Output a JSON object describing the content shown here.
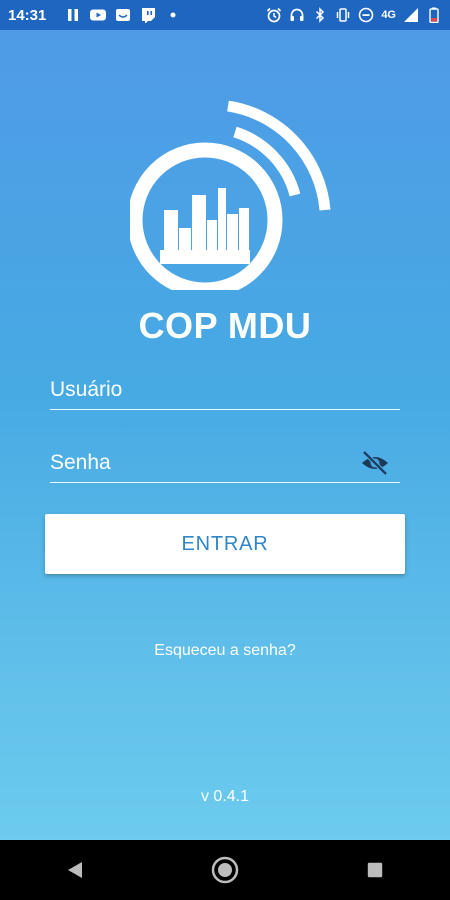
{
  "status_bar": {
    "time": "14:31",
    "network_label": "4G",
    "left_icons": [
      "pause-icon",
      "youtube-icon",
      "message-icon",
      "twitch-icon",
      "dot-icon"
    ],
    "right_icons": [
      "alarm-icon",
      "headset-icon",
      "bluetooth-icon",
      "vibrate-icon",
      "do-not-disturb-icon",
      "signal-icon",
      "battery-icon"
    ]
  },
  "app": {
    "title": "COP MDU",
    "logo_icon": "city-signal-logo-icon"
  },
  "login": {
    "username_placeholder": "Usuário",
    "password_placeholder": "Senha",
    "toggle_visibility_icon": "eye-off-icon",
    "submit_label": "ENTRAR",
    "forgot_password": "Esqueceu a senha?"
  },
  "footer": {
    "version": "v 0.4.1"
  },
  "nav_bar": {
    "buttons": [
      "back-icon",
      "home-icon",
      "recents-icon"
    ]
  },
  "colors": {
    "status_bar": "#1f66c0",
    "gradient_top": "#4f9be6",
    "gradient_bottom": "#6ccbee",
    "button_text": "#2f86c9"
  }
}
